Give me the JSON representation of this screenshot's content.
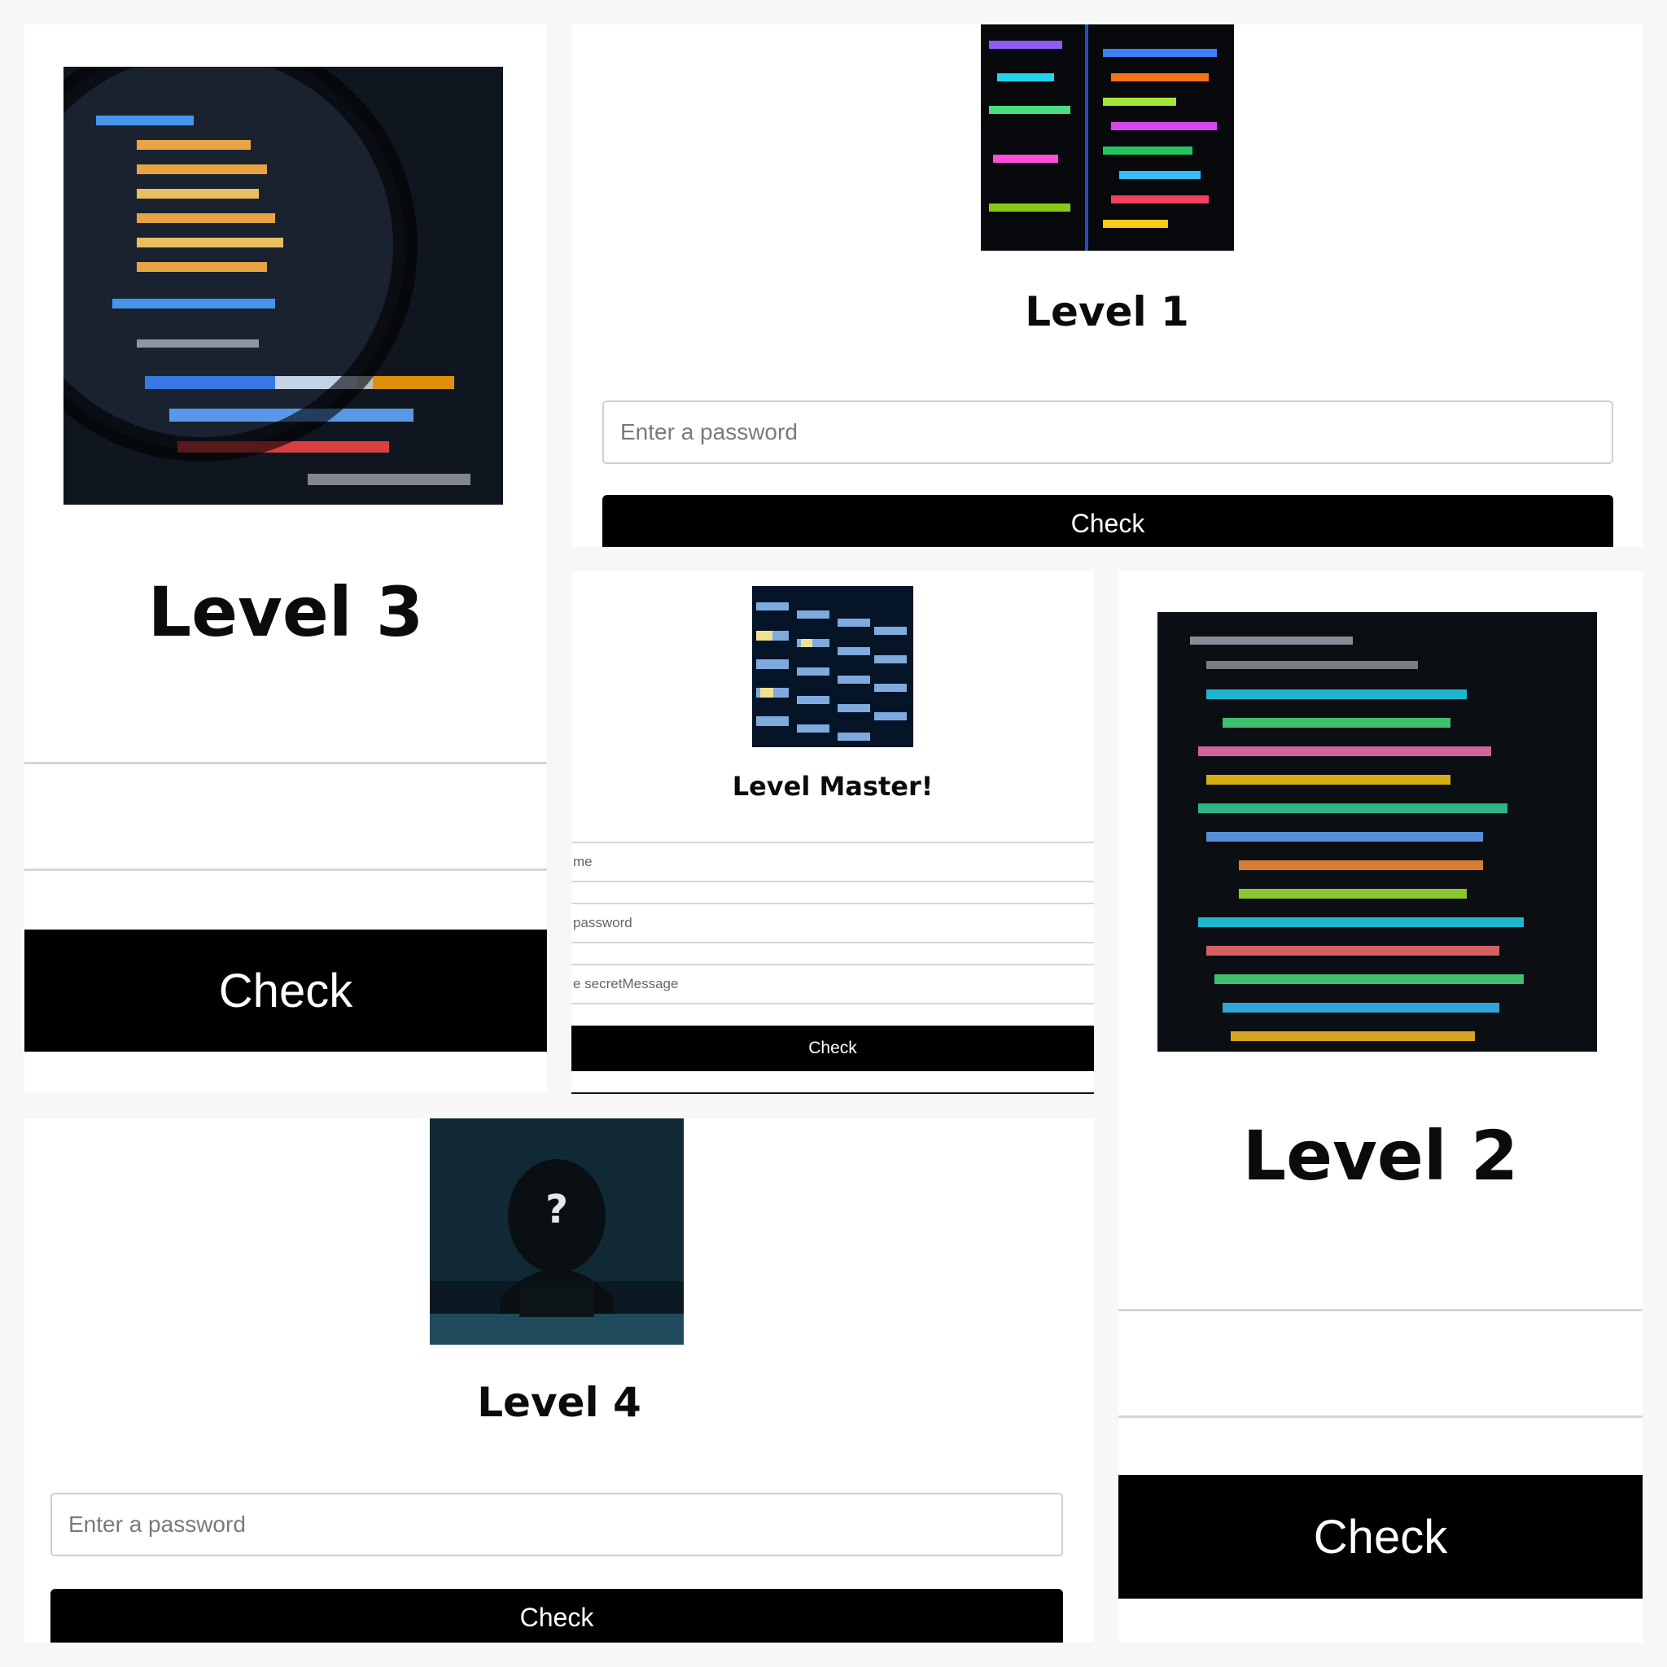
{
  "level3": {
    "image_alt": "magnified code on screen",
    "title": "Level 3",
    "button_label": "Check"
  },
  "level1": {
    "image_alt": "colorful code editor",
    "title": "Level 1",
    "password_placeholder": "Enter a password",
    "button_label": "Check"
  },
  "master": {
    "image_alt": "binary digits matrix",
    "title": "Level Master!",
    "name_placeholder": "me",
    "password_placeholder": "password",
    "secret_placeholder": "e secretMessage",
    "button_label": "Check"
  },
  "level2": {
    "image_alt": "blurred code on monitor",
    "title": "Level 2",
    "button_label": "Check"
  },
  "level4": {
    "image_alt": "hooded hacker with question mark",
    "title": "Level 4",
    "password_placeholder": "Enter a password",
    "button_label": "Check"
  },
  "colors": {
    "background": "#f7f7f7",
    "panel": "#ffffff",
    "button": "#000000",
    "button_text": "#ffffff",
    "input_border": "#cfcfcf"
  }
}
